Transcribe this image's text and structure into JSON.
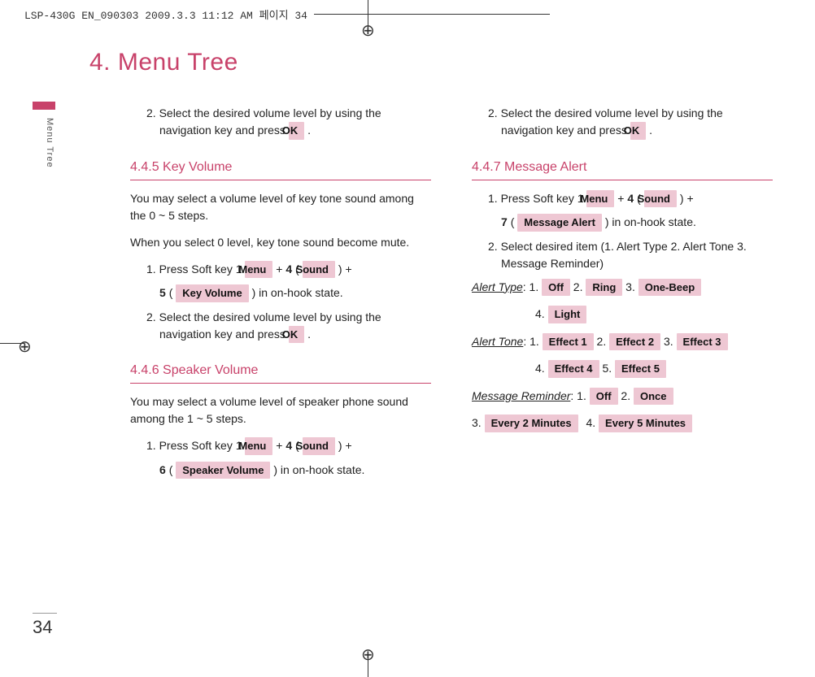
{
  "print_header": "LSP-430G EN_090303  2009.3.3 11:12 AM  페이지 34",
  "side_label": "Menu Tree",
  "chapter_title": "4. Menu Tree",
  "page_number": "34",
  "btn": {
    "ok": "OK",
    "menu": "Menu",
    "sound": "Sound",
    "key_volume_label": "Key Volume",
    "speaker_volume_label": "Speaker Volume",
    "message_alert": "Message Alert",
    "off": "Off",
    "ring": "Ring",
    "one_beep": "One-Beep",
    "light": "Light",
    "effect1": "Effect 1",
    "effect2": "Effect 2",
    "effect3": "Effect 3",
    "effect4": "Effect 4",
    "effect5": "Effect 5",
    "once": "Once",
    "every2": "Every 2 Minutes",
    "every5": "Every 5 Minutes"
  },
  "num": {
    "four": "4",
    "five": "5",
    "six": "6",
    "seven": "7"
  },
  "left": {
    "step2a": "2. Select the desired volume level by using the navigation key and press ",
    "step2a_end": " .",
    "sec445_title": "4.4.5 Key Volume",
    "sec445_p1": "You may select a volume level of key tone sound among the 0 ~ 5 steps.",
    "sec445_p2": "When you select 0 level, key tone sound become mute.",
    "sec445_step1a": "1. Press Soft key 1 ",
    "sec445_step1b": " + ",
    "sec445_step1c": "( ",
    "sec445_step1d": " ) + ",
    "sec445_step1e": "( ",
    "sec445_step1f": " ) in on-hook state.",
    "sec445_step2": "2. Select the desired volume level by using the navigation key and press ",
    "sec445_step2_end": " .",
    "sec446_title": "4.4.6 Speaker Volume",
    "sec446_p1": "You may select a volume level of speaker phone sound among the 1 ~ 5 steps.",
    "sec446_step1a": "1. Press Soft key 1 ",
    "sec446_step1b": " + ",
    "sec446_step1c": "( ",
    "sec446_step1d": " ) + ",
    "sec446_step1e": "( ",
    "sec446_step1f": " ) in on-hook state."
  },
  "right": {
    "step2a": "2. Select the desired volume level by using the navigation key and press ",
    "step2a_end": " .",
    "sec447_title": "4.4.7 Message Alert",
    "sec447_step1a": "1. Press Soft key 1 ",
    "sec447_step1b": " + ",
    "sec447_step1c": "( ",
    "sec447_step1d": " ) + ",
    "sec447_step1e": "( ",
    "sec447_step1f": " ) in on-hook state.",
    "sec447_step2": "2. Select desired item (1. Alert Type   2. Alert Tone 3. Message Reminder)",
    "alert_type_label": "Alert Type",
    "alert_tone_label": "Alert Tone",
    "message_reminder_label": "Message Reminder",
    "sep_colon": ": ",
    "o1": "1. ",
    "o2": "  2. ",
    "o3": "  3. ",
    "o4": "4. ",
    "o5": "  5. "
  }
}
